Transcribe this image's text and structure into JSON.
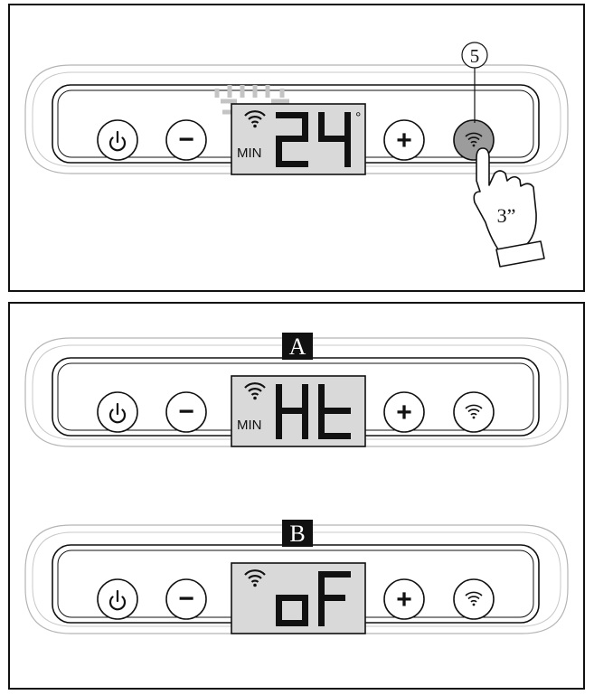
{
  "panel1": {
    "display": {
      "mode_label": "MIN",
      "value": "24",
      "degree": "°"
    },
    "buttons": {
      "power": "power",
      "minus": "−",
      "plus": "+",
      "wifi": "wifi"
    },
    "callout": "5",
    "hold_time": "3”"
  },
  "panel2": {
    "state_a": {
      "tag": "A",
      "mode_label": "MIN",
      "value": "Ht"
    },
    "state_b": {
      "tag": "B",
      "value": "oF"
    }
  },
  "colors": {
    "lcd": "#d9d9d9",
    "wifi_pressed": "#9c9c9c",
    "frame": "#111111"
  }
}
